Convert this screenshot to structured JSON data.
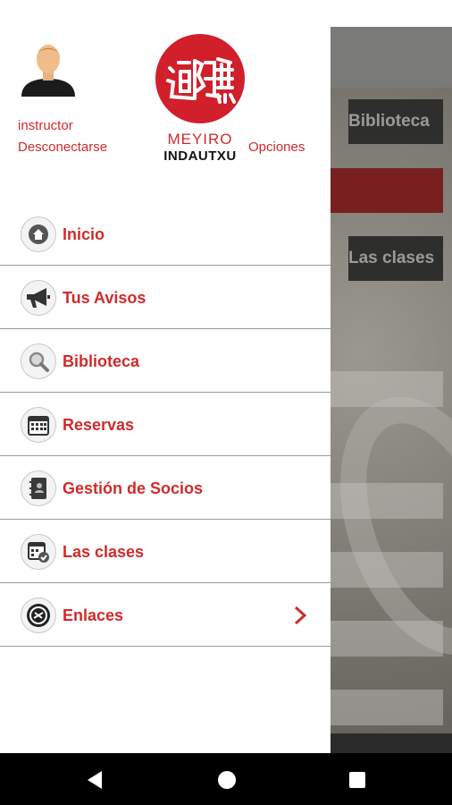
{
  "background": {
    "tiles": [
      "Biblioteca",
      "Las clases"
    ]
  },
  "drawer": {
    "user": {
      "name": "instructor",
      "logout_label": "Desconectarse"
    },
    "logo": {
      "line1": "MEYIRO",
      "line2": "INDAUTXU"
    },
    "options_label": "Opciones",
    "menu": [
      {
        "label": "Inicio",
        "icon": "home-icon"
      },
      {
        "label": "Tus Avisos",
        "icon": "megaphone-icon"
      },
      {
        "label": "Biblioteca",
        "icon": "magnifier-icon"
      },
      {
        "label": "Reservas",
        "icon": "calendar-icon"
      },
      {
        "label": "Gestión de Socios",
        "icon": "address-book-icon"
      },
      {
        "label": "Las clases",
        "icon": "calendar-check-icon"
      },
      {
        "label": "Enlaces",
        "icon": "link-icon",
        "has_submenu": true
      }
    ]
  },
  "navbar": {
    "buttons": [
      "back-icon",
      "home-circle-icon",
      "recents-icon"
    ]
  },
  "colors": {
    "accent": "#d12a2a",
    "divider": "#9a9a9a",
    "navbar": "#000000"
  }
}
